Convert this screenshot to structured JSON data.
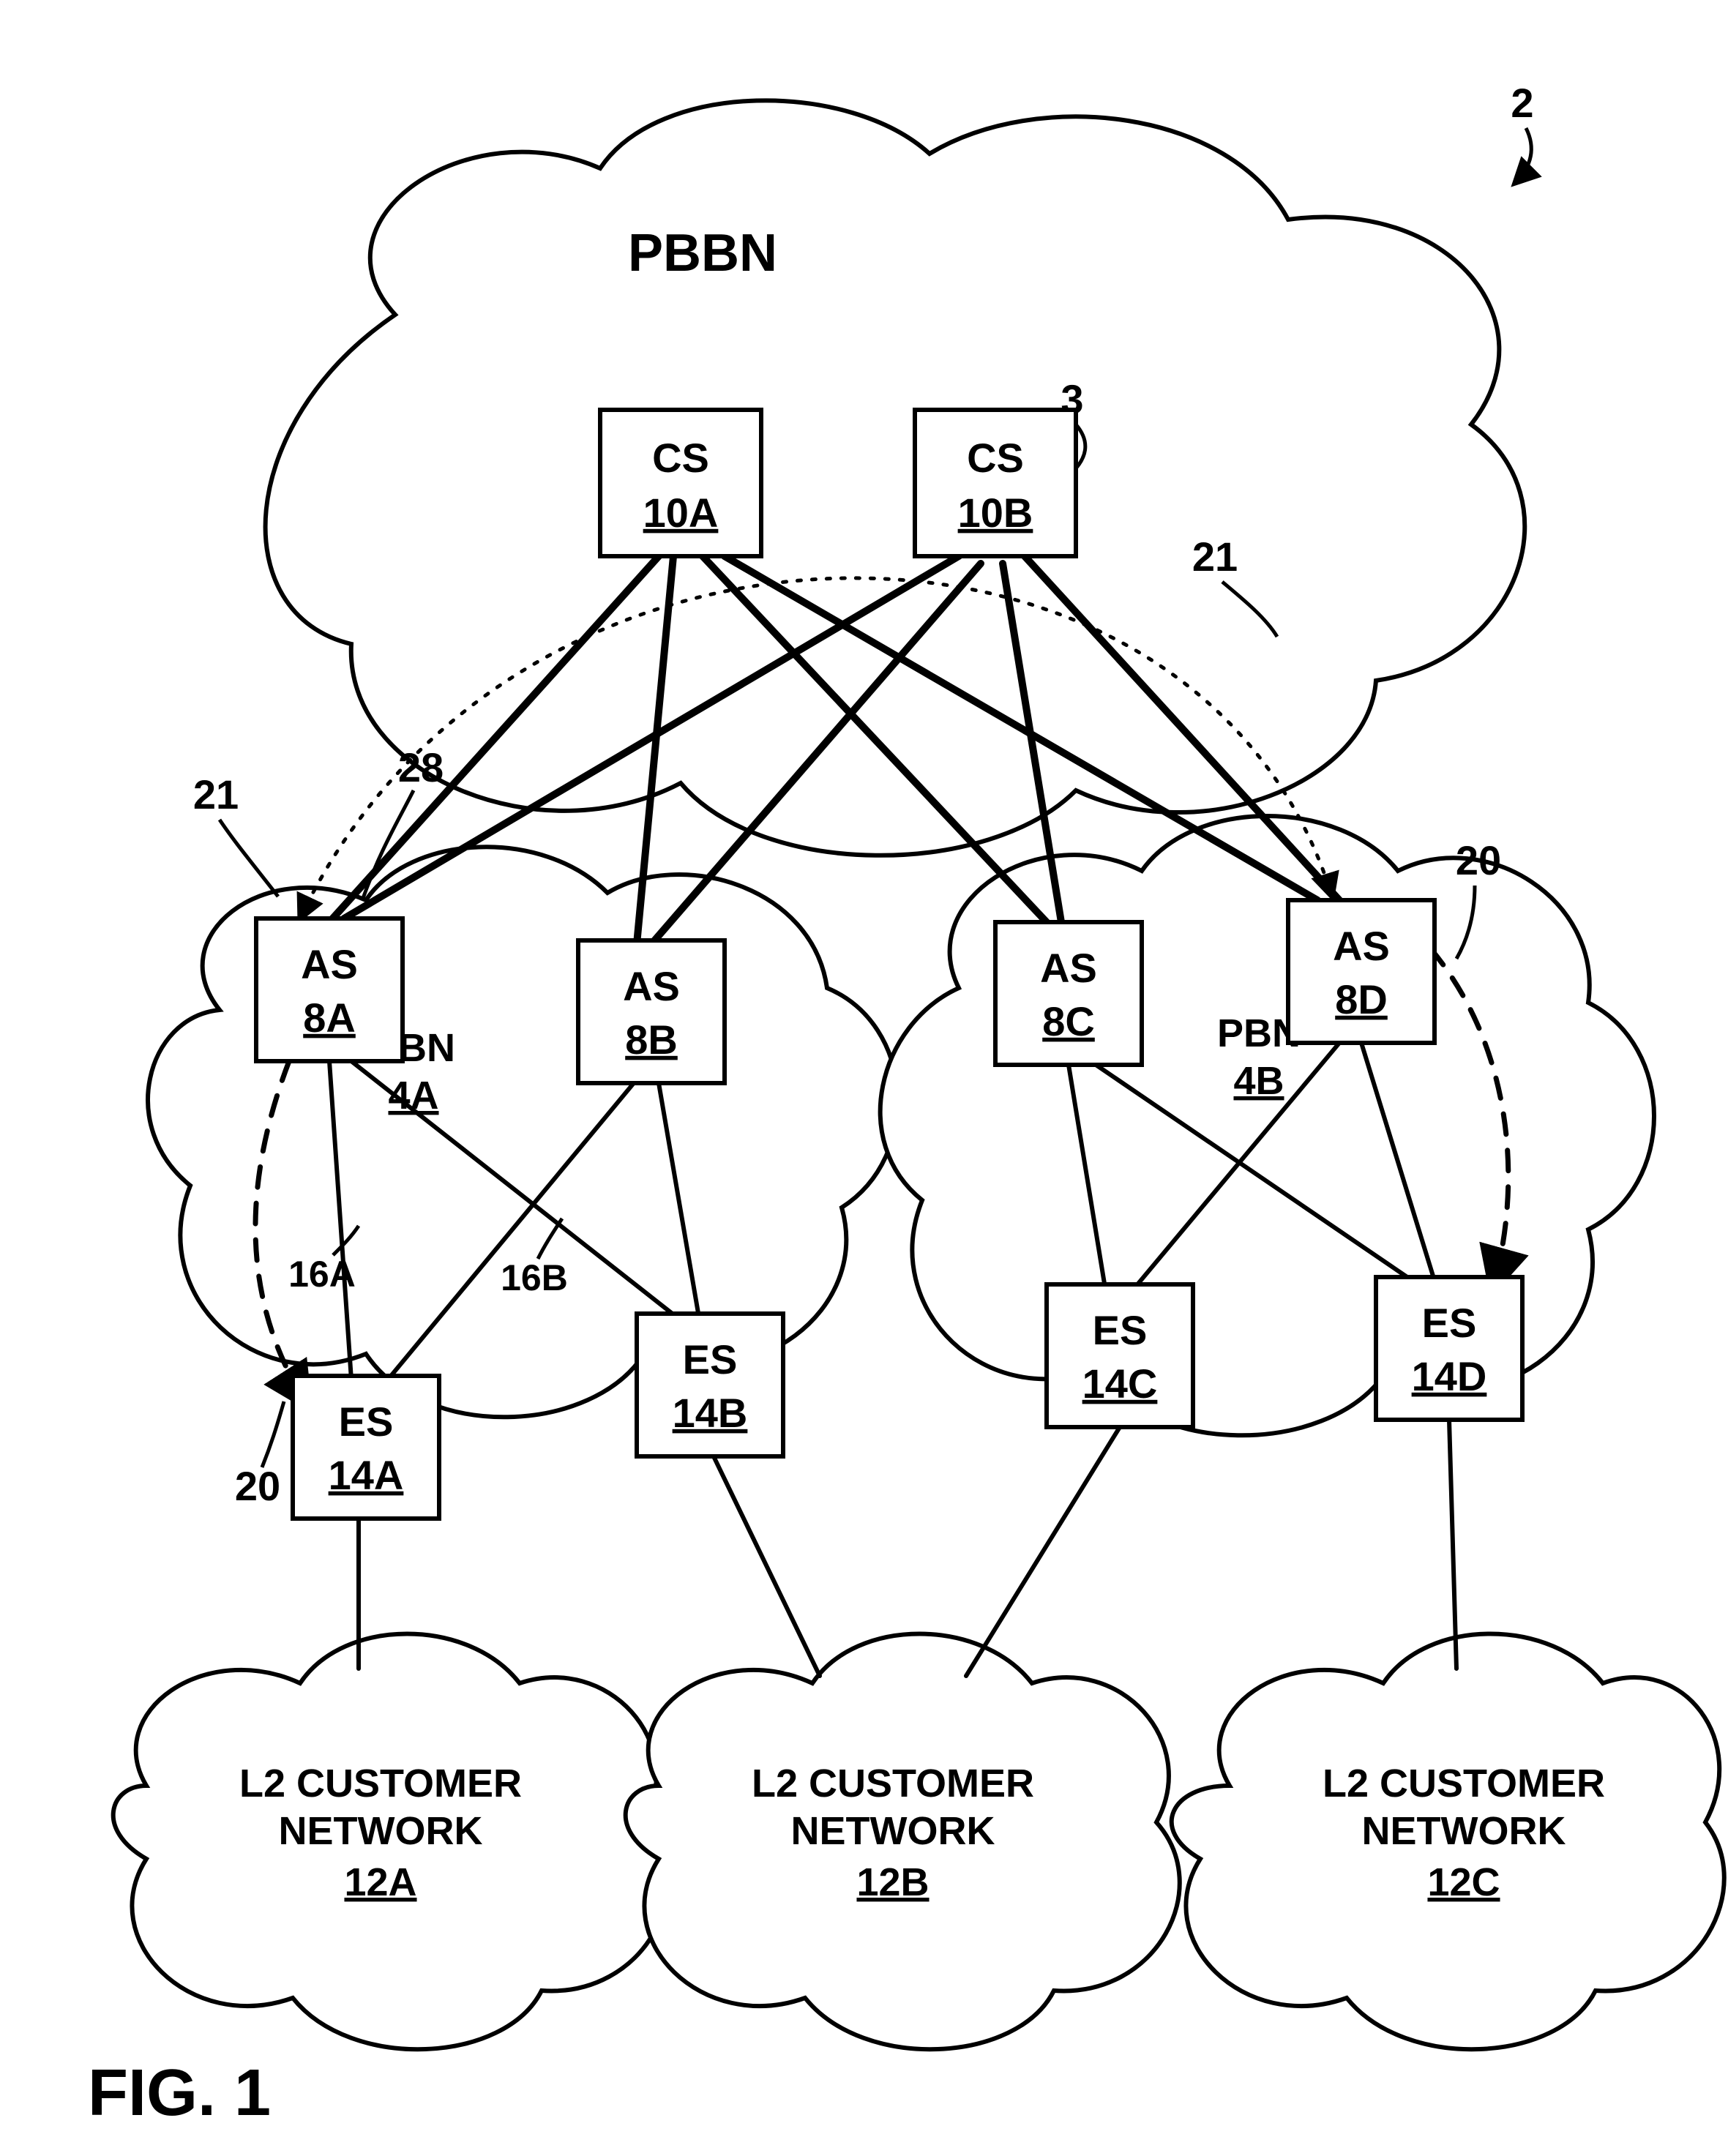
{
  "figure": "FIG. 1",
  "diagram_ref": "2",
  "inner_ref": "3",
  "pbbn": {
    "label": "PBBN"
  },
  "pbn": {
    "a": {
      "label": "PBN",
      "id": "4A"
    },
    "b": {
      "label": "PBN",
      "id": "4B"
    }
  },
  "cs": {
    "a": {
      "label": "CS",
      "id": "10A"
    },
    "b": {
      "label": "CS",
      "id": "10B"
    }
  },
  "as": {
    "a": {
      "label": "AS",
      "id": "8A"
    },
    "b": {
      "label": "AS",
      "id": "8B"
    },
    "c": {
      "label": "AS",
      "id": "8C"
    },
    "d": {
      "label": "AS",
      "id": "8D"
    }
  },
  "es": {
    "a": {
      "label": "ES",
      "id": "14A"
    },
    "b": {
      "label": "ES",
      "id": "14B"
    },
    "c": {
      "label": "ES",
      "id": "14C"
    },
    "d": {
      "label": "ES",
      "id": "14D"
    }
  },
  "customer": {
    "a": {
      "line1": "L2 CUSTOMER",
      "line2": "NETWORK",
      "id": "12A"
    },
    "b": {
      "line1": "L2 CUSTOMER",
      "line2": "NETWORK",
      "id": "12B"
    },
    "c": {
      "line1": "L2 CUSTOMER",
      "line2": "NETWORK",
      "id": "12C"
    }
  },
  "annotations": {
    "left28": "28",
    "left21": "21",
    "right21": "21",
    "left20": "20",
    "right20": "20",
    "l16a": "16A",
    "l16b": "16B"
  }
}
